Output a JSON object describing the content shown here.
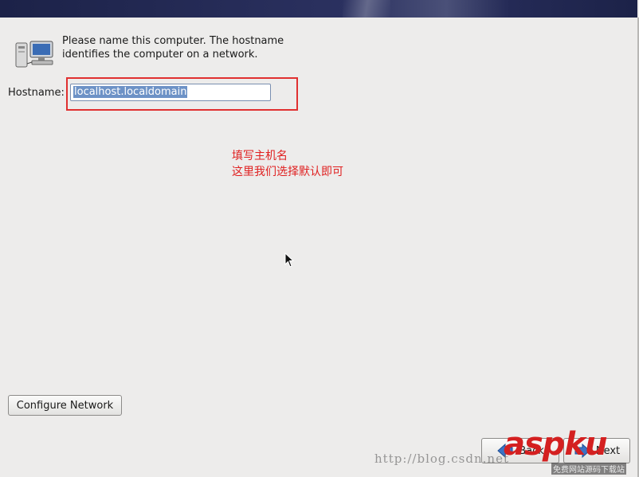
{
  "description": "Please name this computer.  The hostname identifies the computer on a network.",
  "hostname": {
    "label": "Hostname:",
    "value": "localhost.localdomain"
  },
  "annotation": {
    "line1": "填写主机名",
    "line2": "这里我们选择默认即可"
  },
  "buttons": {
    "configure_network": "Configure Network",
    "back": "Back",
    "next": "Next"
  },
  "watermark": {
    "url": "http://blog.csdn.net",
    "logo": "aspku",
    "logo_sub": "免费网站源码下载站"
  },
  "colors": {
    "annotation": "#e02020",
    "selection": "#6d92c6",
    "title_bar": "#1c2248"
  },
  "icons": [
    "computer-network-icon",
    "back-arrow-icon",
    "next-arrow-icon",
    "mouse-cursor-icon"
  ]
}
